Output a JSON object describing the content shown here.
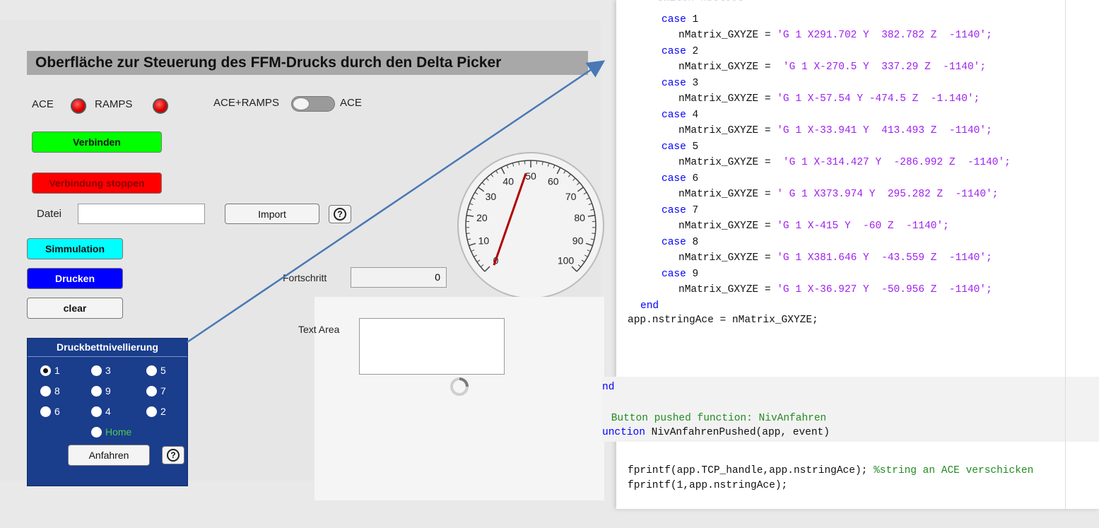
{
  "app": {
    "title": "Oberfläche zur Steuerung des FFM-Drucks durch den Delta Picker",
    "led_labels": [
      "ACE",
      "RAMPS"
    ],
    "switch_left_label": "ACE+RAMPS",
    "switch_right_label": "ACE",
    "connect_button": "Verbinden",
    "disconnect_button": "Verbindung stoppen",
    "file_label": "Datei",
    "file_value": "",
    "import_button": "Import",
    "simulation_button": "Simmulation",
    "print_button": "Drucken",
    "clear_button": "clear",
    "progress_label": "Fortschritt",
    "progress_value": "0",
    "text_area_label": "Text Area",
    "gauge": {
      "ticks": [
        "0",
        "10",
        "20",
        "30",
        "40",
        "50",
        "60",
        "70",
        "80",
        "90",
        "100"
      ],
      "value": 48,
      "min": 0,
      "max": 100
    },
    "leveling": {
      "title": "Druckbettnivellierung",
      "options": [
        "1",
        "3",
        "5",
        "8",
        "9",
        "7",
        "6",
        "4",
        "2"
      ],
      "home_label": "Home",
      "selected": "1",
      "approach_button": "Anfahren"
    },
    "colors": {
      "connect": "#00ff00",
      "disconnect": "#ff0000",
      "simulation": "#00ffff",
      "print": "#0000ff",
      "leveling_bg": "#1a3d8c",
      "home_text": "#4fc94f"
    }
  },
  "code": {
    "header_partial": "switch nSelect",
    "cases": [
      {
        "label": "case 1",
        "value": "'G 1 X291.702 Y  382.782 Z  -1140';"
      },
      {
        "label": "case 2",
        "value": " 'G 1 X-270.5 Y  337.29 Z  -1140';"
      },
      {
        "label": "case 3",
        "value": "'G 1 X-57.54 Y -474.5 Z  -1.140';"
      },
      {
        "label": "case 4",
        "value": "'G 1 X-33.941 Y  413.493 Z  -1140';"
      },
      {
        "label": "case 5",
        "value": " 'G 1 X-314.427 Y  -286.992 Z  -1140';"
      },
      {
        "label": "case 6",
        "value": "' G 1 X373.974 Y  295.282 Z  -1140';"
      },
      {
        "label": "case 7",
        "value": "'G 1 X-415 Y  -60 Z  -1140';"
      },
      {
        "label": "case 8",
        "value": "'G 1 X381.646 Y  -43.559 Z  -1140';"
      },
      {
        "label": "case 9",
        "value": "'G 1 X-36.927 Y  -50.956 Z  -1140';"
      }
    ],
    "assign_prefix": "nMatrix_GXYZE = ",
    "end_keyword": "end",
    "assign_line": "app.nstringAce = nMatrix_GXYZE;",
    "nd_line": "nd",
    "comment_line": " Button pushed function: NivAnfahren",
    "function_kw": "unction",
    "function_sig": " NivAnfahrenPushed(app, event)",
    "fprintf1_code": "fprintf(app.TCP_handle,app.nstringAce); ",
    "fprintf1_comment": "%string an ACE verschicken",
    "fprintf2_code": "fprintf(1,app.nstringAce);"
  }
}
